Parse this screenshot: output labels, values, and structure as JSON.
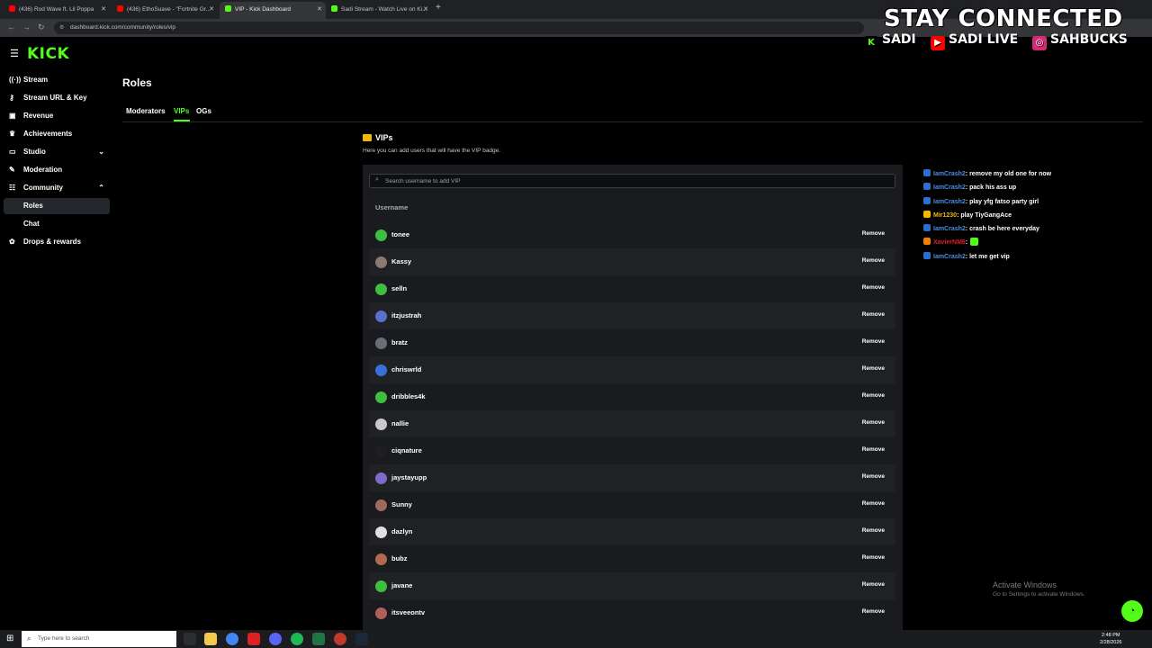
{
  "browser": {
    "tabs": [
      {
        "title": "(436) Rod Wave ft. Lil Poppa",
        "active": false,
        "color": "#ff0000"
      },
      {
        "title": "(436) EthoSuave - \"Fortnite Gr...",
        "active": false,
        "color": "#ff0000"
      },
      {
        "title": "VIP - Kick Dashboard",
        "active": true,
        "color": "#53fc18"
      },
      {
        "title": "Sadi Stream - Watch Live on Ki...",
        "active": false,
        "color": "#53fc18"
      }
    ],
    "url": "dashboard.kick.com/community/roles/vip"
  },
  "overlay": {
    "headline": "STAY CONNECTED",
    "kick_handle": "SADI",
    "youtube_handle": "SADI LIVE",
    "instagram_handle": "SAHBUCKS"
  },
  "sidebar": {
    "logo": "KICK",
    "items": [
      {
        "label": "Stream",
        "icon": "stream-icon",
        "glyph": "((·))"
      },
      {
        "label": "Stream URL & Key",
        "icon": "key-icon",
        "glyph": "⚷"
      },
      {
        "label": "Revenue",
        "icon": "revenue-icon",
        "glyph": "▣"
      },
      {
        "label": "Achievements",
        "icon": "trophy-icon",
        "glyph": "♛"
      },
      {
        "label": "Studio",
        "icon": "studio-icon",
        "glyph": "▭"
      },
      {
        "label": "Moderation",
        "icon": "wrench-icon",
        "glyph": "✎"
      },
      {
        "label": "Community",
        "icon": "community-icon",
        "glyph": "☷"
      },
      {
        "label": "Roles",
        "icon": "",
        "glyph": ""
      },
      {
        "label": "Chat",
        "icon": "",
        "glyph": ""
      },
      {
        "label": "Drops & rewards",
        "icon": "gift-icon",
        "glyph": "✿"
      }
    ]
  },
  "page": {
    "title": "Roles",
    "tabs": [
      "Moderators",
      "VIPs",
      "OGs"
    ],
    "active_tab": "VIPs",
    "section_title": "VIPs",
    "section_desc": "Here you can add users that will have the VIP badge.",
    "search_placeholder": "Search username to add VIP",
    "column_header": "Username",
    "remove_label": "Remove",
    "users": [
      {
        "name": "tonee",
        "avatar_color": "#3fbf3f"
      },
      {
        "name": "Kassy",
        "avatar_color": "#8a7a72"
      },
      {
        "name": "selln",
        "avatar_color": "#3fbf3f"
      },
      {
        "name": "itzjustrah",
        "avatar_color": "#5a6fd0"
      },
      {
        "name": "bratz",
        "avatar_color": "#6b6f75"
      },
      {
        "name": "chriswrld",
        "avatar_color": "#3b6fd8"
      },
      {
        "name": "dribbles4k",
        "avatar_color": "#3fbf3f"
      },
      {
        "name": "nallie",
        "avatar_color": "#c9c9c9"
      },
      {
        "name": "ciqnature",
        "avatar_color": "#1f1f1f"
      },
      {
        "name": "jaystayupp",
        "avatar_color": "#7d6ac9"
      },
      {
        "name": "Sunny",
        "avatar_color": "#a06a5a"
      },
      {
        "name": "dazlyn",
        "avatar_color": "#e0e0e0"
      },
      {
        "name": "bubz",
        "avatar_color": "#b06a50"
      },
      {
        "name": "javane",
        "avatar_color": "#3fbf3f"
      },
      {
        "name": "itsveeontv",
        "avatar_color": "#b0605a"
      }
    ]
  },
  "chat": [
    {
      "user": "IamCrash2",
      "msg": ": remove my old one for now",
      "color": "#4a90e2",
      "badge": "#2a6fd0"
    },
    {
      "user": "IamCrash2",
      "msg": ": pack his ass up",
      "color": "#4a90e2",
      "badge": "#2a6fd0"
    },
    {
      "user": "IamCrash2",
      "msg": ": play yfg fatso party girl",
      "color": "#4a90e2",
      "badge": "#2a6fd0"
    },
    {
      "user": "Mir1230",
      "msg": ": play TiyGangAce",
      "color": "#f5b800",
      "badge": "#f5b800"
    },
    {
      "user": "IamCrash2",
      "msg": ": crash be here everyday",
      "color": "#4a90e2",
      "badge": "#2a6fd0"
    },
    {
      "user": "XavierNM6",
      "msg": ":",
      "color": "#e02020",
      "badge": "#f57c00"
    },
    {
      "user": "IamCrash2",
      "msg": ": let me get vip",
      "color": "#4a90e2",
      "badge": "#2a6fd0"
    }
  ],
  "watermark": {
    "line1": "Activate Windows",
    "line2": "Go to Settings to activate Windows."
  },
  "taskbar": {
    "search_placeholder": "Type here to search",
    "time": "2:48 PM",
    "date": "2/28/2026"
  }
}
